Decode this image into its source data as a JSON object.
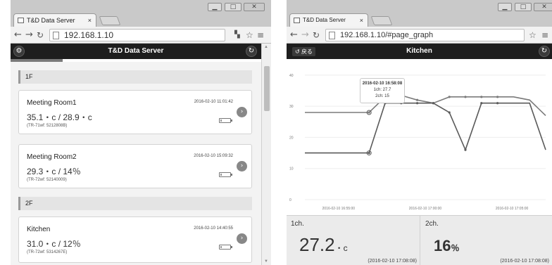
{
  "left": {
    "tab_title": "T&D Data Server",
    "url": "192.168.1.10",
    "app_title": "T&D Data Server",
    "floors": [
      {
        "label": "1F"
      },
      {
        "label": "2F"
      }
    ],
    "cards": [
      {
        "name": "Meeting Room1",
        "reading": "35.1・c / 28.9・c",
        "model": "(TR-71wf: 5212808B)",
        "timestamp": "2016-02-10 11:01:42"
      },
      {
        "name": "Meeting Room2",
        "reading": "29.3・c / 14％",
        "model": "(TR-72wf: 52140009)",
        "timestamp": "2016-02-10 15:09:32"
      },
      {
        "name": "Kitchen",
        "reading": "31.0・c / 12％",
        "model": "(TR-72wf: 5314267E)",
        "timestamp": "2016-02-10 14:40:55"
      }
    ]
  },
  "right": {
    "tab_title": "T&D Data Server",
    "url": "192.168.1.10/#page_graph",
    "back_label": "戻る",
    "app_title": "Kitchen",
    "tooltip": {
      "time": "2016-02-10 16:58:08",
      "ch1": "1ch: 27.7",
      "ch2": "2ch: 15"
    },
    "ch1": {
      "label": "1ch.",
      "value": "27.2",
      "unit": "・c",
      "time": "(2016-02-10 17:08:08)"
    },
    "ch2": {
      "label": "2ch.",
      "value": "16",
      "unit": "％",
      "time": "(2016-02-10 17:08:08)"
    }
  },
  "chart_data": {
    "type": "line",
    "x": [
      "16:54:00",
      "16:55:00",
      "16:56:00",
      "16:57:00",
      "16:58:00",
      "16:58:30",
      "16:59:00",
      "17:00:00",
      "17:01:00",
      "17:02:00",
      "17:02:30",
      "17:03:00",
      "17:04:00",
      "17:05:00",
      "17:06:00",
      "17:08:00"
    ],
    "x_ticks": [
      "2016-02-10 16:55:00",
      "2016-02-10 17:00:00",
      "2016-02-10 17:05:00"
    ],
    "y_ticks": [
      0,
      10,
      20,
      30,
      40
    ],
    "ylim": [
      0,
      42
    ],
    "series": [
      {
        "values": [
          28,
          28,
          28,
          28,
          28,
          33,
          33.5,
          32,
          31,
          33,
          33,
          33,
          33,
          33,
          32,
          27
        ]
      },
      {
        "values": [
          15,
          15,
          15,
          15,
          15,
          31,
          31,
          31,
          31,
          28,
          16,
          31,
          31,
          31,
          31,
          16
        ]
      }
    ],
    "grid": true,
    "colors": [
      "#7a7a7a",
      "#5a5a5a"
    ]
  }
}
